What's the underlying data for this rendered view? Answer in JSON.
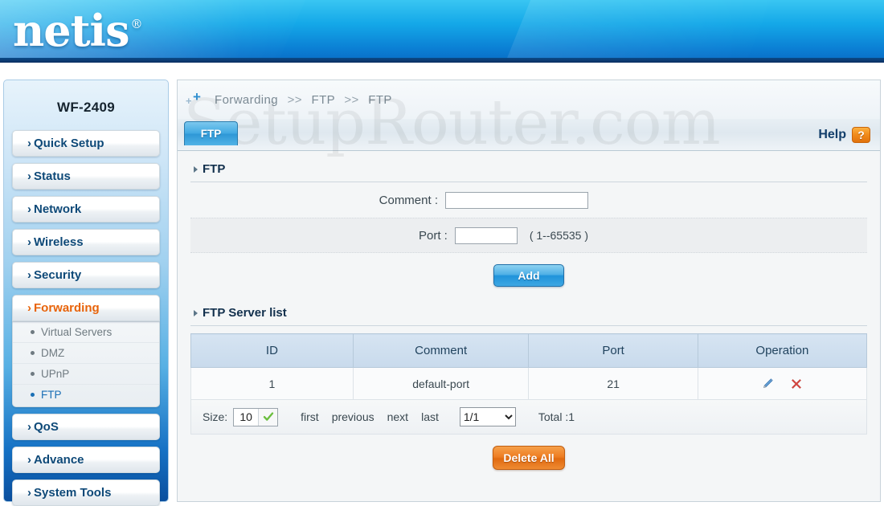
{
  "header": {
    "brand": "netis",
    "registered": "®"
  },
  "watermark": {
    "text": "SetupRouter.com"
  },
  "sidebar": {
    "model": "WF-2409",
    "chevron": "›",
    "items": [
      {
        "label": "Quick Setup",
        "active": false
      },
      {
        "label": "Status",
        "active": false
      },
      {
        "label": "Network",
        "active": false
      },
      {
        "label": "Wireless",
        "active": false
      },
      {
        "label": "Security",
        "active": false
      },
      {
        "label": "Forwarding",
        "active": true
      }
    ],
    "submenu": [
      {
        "label": "Virtual Servers",
        "active": false
      },
      {
        "label": "DMZ",
        "active": false
      },
      {
        "label": "UPnP",
        "active": false
      },
      {
        "label": "FTP",
        "active": true
      }
    ],
    "items_after": [
      {
        "label": "QoS",
        "active": false
      },
      {
        "label": "Advance",
        "active": false
      },
      {
        "label": "System Tools",
        "active": false
      }
    ]
  },
  "breadcrumb": {
    "part1": "Forwarding",
    "sep1": ">>",
    "part2": "FTP",
    "sep2": ">>",
    "part3": "FTP"
  },
  "tab": {
    "label": "FTP"
  },
  "help": {
    "label": "Help",
    "icon_text": "?"
  },
  "form": {
    "section_title": "FTP",
    "comment_label": "Comment :",
    "comment_value": "",
    "port_label": "Port :",
    "port_value": "",
    "port_hint": "( 1--65535 )",
    "add_label": "Add"
  },
  "list": {
    "section_title": "FTP Server list",
    "columns": [
      "ID",
      "Comment",
      "Port",
      "Operation"
    ],
    "rows": [
      {
        "id": "1",
        "comment": "default-port",
        "port": "21",
        "edit_icon": "pencil-icon",
        "delete_icon": "delete-x-icon"
      }
    ]
  },
  "pager": {
    "size_label": "Size:",
    "size_value": "10",
    "confirm_icon": "green-check-icon",
    "first": "first",
    "previous": "previous",
    "next": "next",
    "last": "last",
    "page_selected": "1/1",
    "page_options": [
      "1/1"
    ],
    "total": "Total :1"
  },
  "footer": {
    "delete_all_label": "Delete All"
  },
  "colors": {
    "header_blue": "#14a8e8",
    "accent_orange": "#e8630a",
    "active_submenu_blue": "#1a6fb5",
    "table_header_blue": "#c8daec",
    "delete_red": "#d9453f",
    "edit_blue": "#3f7fc1"
  }
}
